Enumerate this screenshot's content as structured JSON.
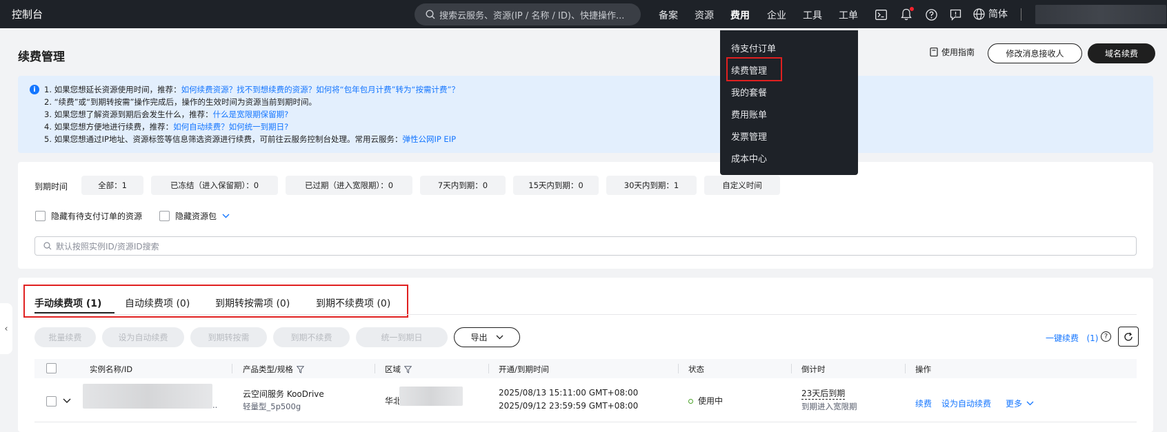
{
  "topbar": {
    "brand": "控制台",
    "search_placeholder": "搜索云服务、资源(IP / 名称 / ID)、快捷操作...",
    "nav": [
      "备案",
      "资源",
      "费用",
      "企业",
      "工具",
      "工单"
    ],
    "active_nav": "费用",
    "language": "简体",
    "icons": [
      "terminal-icon",
      "bell-icon",
      "help-icon",
      "feedback-icon",
      "globe-icon"
    ]
  },
  "dropdown": {
    "items": [
      "待支付订单",
      "续费管理",
      "我的套餐",
      "费用账单",
      "发票管理",
      "成本中心"
    ],
    "highlighted": "续费管理"
  },
  "header": {
    "title": "续费管理",
    "guide": "使用指南",
    "modify_receiver": "修改消息接收人",
    "domain_renew": "域名续费"
  },
  "notice": {
    "line1_text": "1. 如果您想延长资源使用时间，推荐：",
    "line1_link": "如何续费资源？找不到想续费的资源？如何将“包年包月计费”转为“按需计费”？",
    "line2_text": "2. “续费”或“到期转按需”操作完成后，操作的生效时间为资源当前到期时间。",
    "line3_text": "3. 如果您想了解资源到期后会发生什么，推荐：",
    "line3_link": "什么是宽限期保留期?",
    "line4_text": "4. 如果您想方便地进行续费，推荐：",
    "line4_link": "如何自动续费？如何统一到期日?",
    "line5_text": "5. 如果您想通过IP地址、资源标签等信息筛选资源进行续费，可前往云服务控制台处理。常用云服务：",
    "line5_link": "弹性公网IP EIP"
  },
  "filter": {
    "label": "到期时间",
    "chips": [
      "全部：1",
      "已冻结（进入保留期）：0",
      "已过期（进入宽限期）：0",
      "7天内到期：0",
      "15天内到期：0",
      "30天内到期：1",
      "自定义时间"
    ],
    "hide_pending": "隐藏有待支付订单的资源",
    "hide_package": "隐藏资源包",
    "search_placeholder": "默认按照实例ID/资源ID搜索"
  },
  "tabs": [
    "手动续费项 (1)",
    "自动续费项 (0)",
    "到期转按需项 (0)",
    "到期不续费项 (0)"
  ],
  "actions": {
    "batch_renew": "批量续费",
    "set_auto": "设为自动续费",
    "to_ondemand": "到期转按需",
    "no_renew": "到期不续费",
    "unify": "统一到期日",
    "export": "导出",
    "one_click": "一键续费",
    "one_click_count": "(1)"
  },
  "table": {
    "columns": [
      "实例名称/ID",
      "产品类型/规格",
      "区域",
      "开通/到期时间",
      "状态",
      "倒计时",
      "操作"
    ],
    "rows": [
      {
        "id_suffix": "..",
        "product": "云空间服务 KooDrive",
        "spec": "轻量型_5p500g",
        "region_prefix": "华北",
        "open_time": "2025/08/13 15:11:00 GMT+08:00",
        "expire_time": "2025/09/12 23:59:59 GMT+08:00",
        "status": "使用中",
        "countdown": "23天后到期",
        "countdown_sub": "到期进入宽限期",
        "ops": [
          "续费",
          "设为自动续费",
          "更多"
        ]
      }
    ]
  },
  "colors": {
    "topbar": "#1e2228",
    "link": "#1476ff",
    "highlight": "#e02020",
    "status_ok": "#4ca32a"
  }
}
